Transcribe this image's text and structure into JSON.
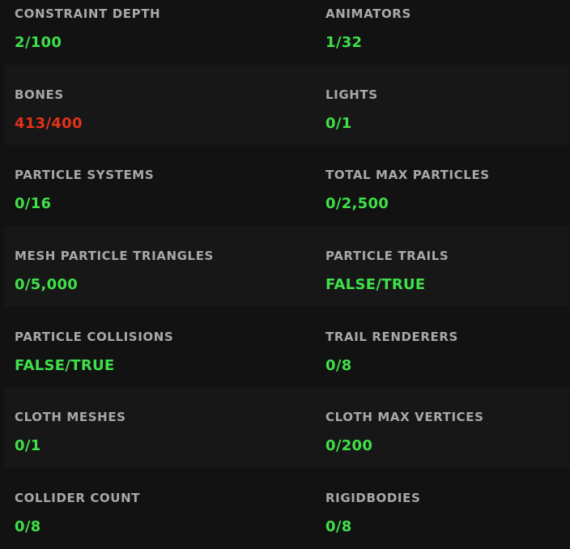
{
  "colors": {
    "ok": "#3fe04a",
    "over_limit": "#e3311a",
    "label": "#a8a8a8",
    "background": "#121212"
  },
  "stats": [
    {
      "left": {
        "label": "CONSTRAINT DEPTH",
        "value": "2/100",
        "status": "ok"
      },
      "right": {
        "label": "ANIMATORS",
        "value": "1/32",
        "status": "ok"
      }
    },
    {
      "left": {
        "label": "BONES",
        "value": "413/400",
        "status": "over"
      },
      "right": {
        "label": "LIGHTS",
        "value": "0/1",
        "status": "ok"
      }
    },
    {
      "left": {
        "label": "PARTICLE SYSTEMS",
        "value": "0/16",
        "status": "ok"
      },
      "right": {
        "label": "TOTAL MAX PARTICLES",
        "value": "0/2,500",
        "status": "ok"
      }
    },
    {
      "left": {
        "label": "MESH PARTICLE TRIANGLES",
        "value": "0/5,000",
        "status": "ok"
      },
      "right": {
        "label": "PARTICLE TRAILS",
        "value": "FALSE/TRUE",
        "status": "ok"
      }
    },
    {
      "left": {
        "label": "PARTICLE COLLISIONS",
        "value": "FALSE/TRUE",
        "status": "ok"
      },
      "right": {
        "label": "TRAIL RENDERERS",
        "value": "0/8",
        "status": "ok"
      }
    },
    {
      "left": {
        "label": "CLOTH MESHES",
        "value": "0/1",
        "status": "ok"
      },
      "right": {
        "label": "CLOTH MAX VERTICES",
        "value": "0/200",
        "status": "ok"
      }
    },
    {
      "left": {
        "label": "COLLIDER COUNT",
        "value": "0/8",
        "status": "ok"
      },
      "right": {
        "label": "RIGIDBODIES",
        "value": "0/8",
        "status": "ok"
      }
    }
  ]
}
